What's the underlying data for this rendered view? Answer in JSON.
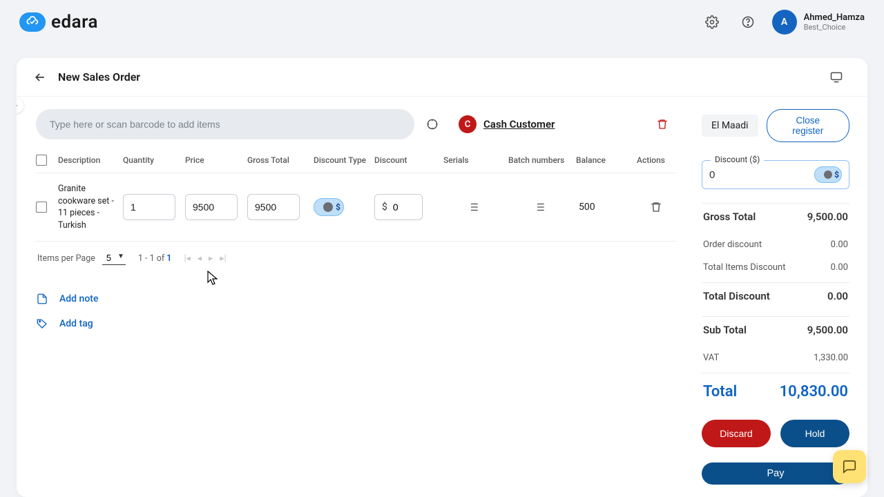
{
  "brand": {
    "name": "edara"
  },
  "user": {
    "initial": "A",
    "name": "Ahmed_Hamza",
    "sub": "Best_Choice"
  },
  "page": {
    "title": "New Sales Order"
  },
  "search": {
    "placeholder": "Type here or scan barcode to add items"
  },
  "customer": {
    "initial": "C",
    "name": "Cash Customer"
  },
  "columns": {
    "description": "Description",
    "quantity": "Quantity",
    "price": "Price",
    "gross_total": "Gross Total",
    "discount_type": "Discount Type",
    "discount": "Discount",
    "serials": "Serials",
    "batch": "Batch numbers",
    "balance": "Balance",
    "actions": "Actions"
  },
  "row": {
    "description": "Granite cookware set - 11 pieces - Turkish",
    "quantity": "1",
    "price": "9500",
    "gross_total": "9500",
    "discount_type_symbol": "$",
    "discount_prefix": "$",
    "discount_value": "0",
    "balance": "500"
  },
  "pagination": {
    "ipp_label": "Items per Page",
    "ipp_value": "5",
    "range_prefix": "1 - 1 of ",
    "range_total": "1"
  },
  "links": {
    "add_note": "Add note",
    "add_tag": "Add tag"
  },
  "right": {
    "location": "El Maadi",
    "close_register": "Close register",
    "discount_label": "Discount ($)",
    "discount_value": "0",
    "discount_symbol": "$"
  },
  "summary": {
    "gross_total_label": "Gross Total",
    "gross_total": "9,500.00",
    "order_discount_label": "Order discount",
    "order_discount": "0.00",
    "items_discount_label": "Total Items Discount",
    "items_discount": "0.00",
    "total_discount_label": "Total Discount",
    "total_discount": "0.00",
    "sub_total_label": "Sub Total",
    "sub_total": "9,500.00",
    "vat_label": "VAT",
    "vat": "1,330.00",
    "total_label": "Total",
    "total": "10,830.00"
  },
  "buttons": {
    "discard": "Discard",
    "hold": "Hold",
    "pay": "Pay"
  }
}
